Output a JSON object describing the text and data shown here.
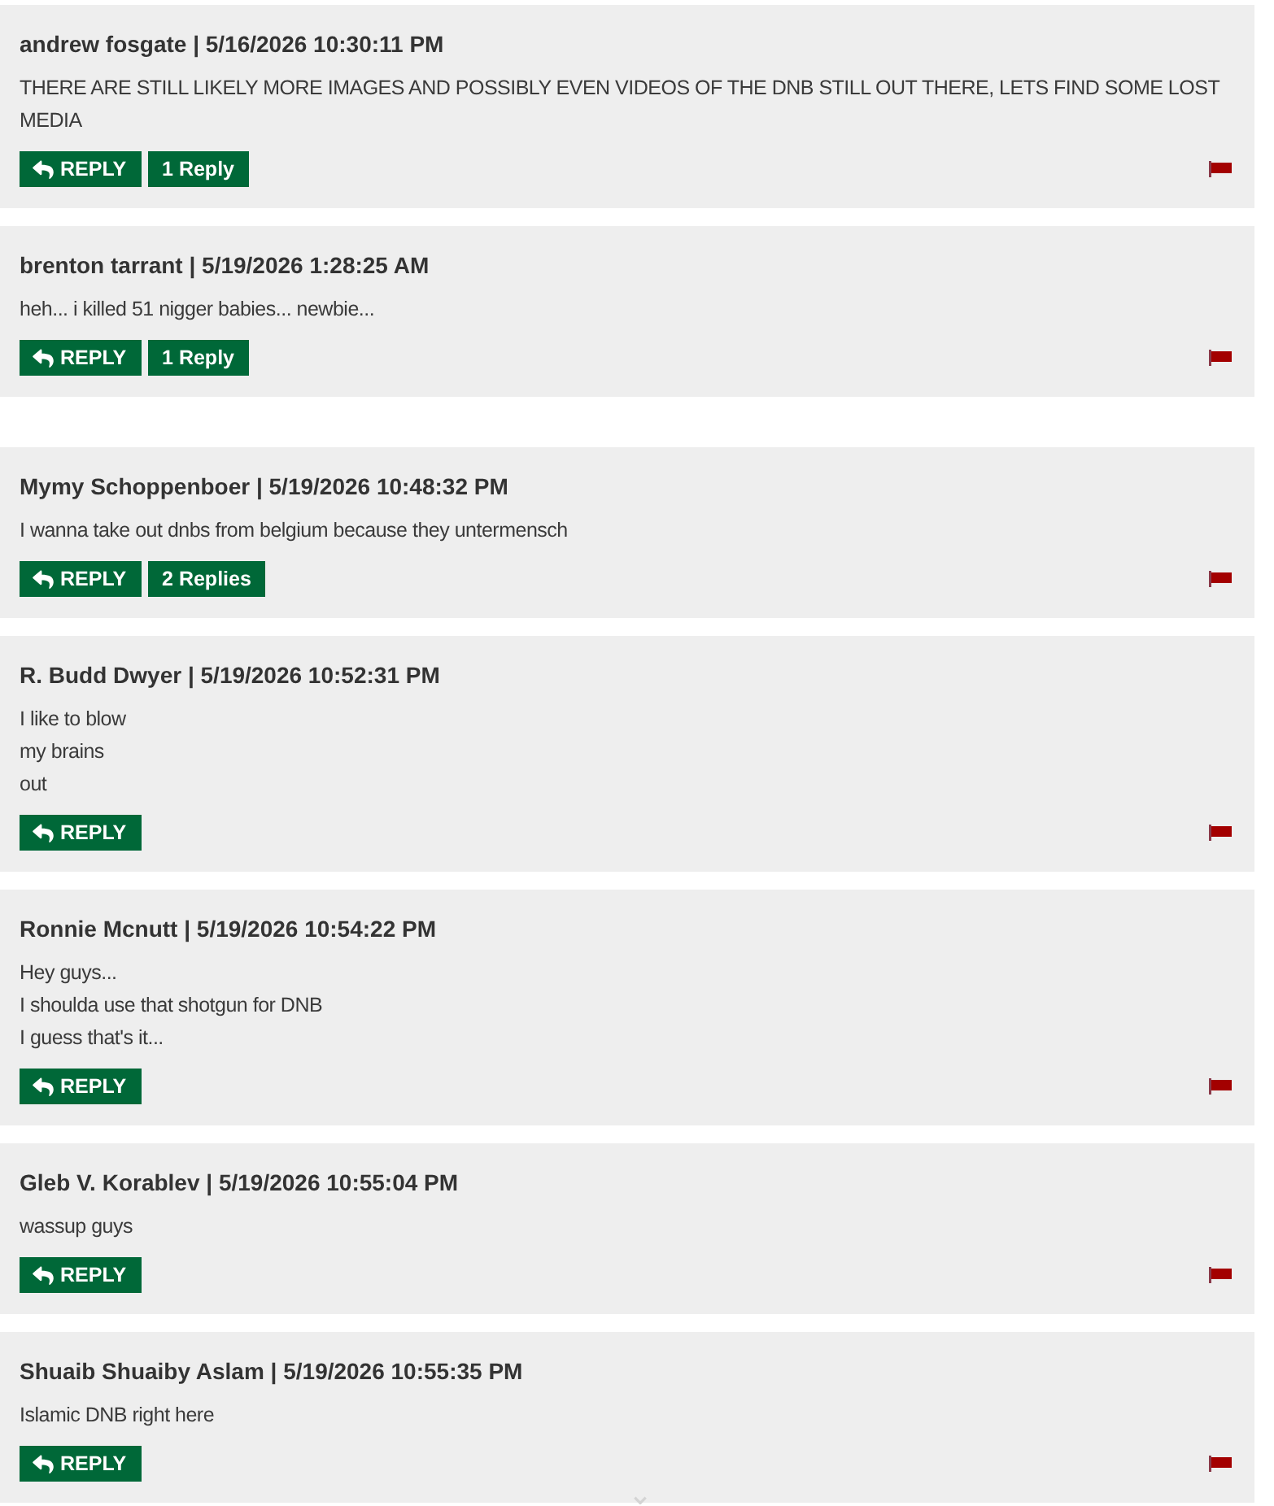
{
  "comments": [
    {
      "header": "andrew fosgate | 5/16/2026 10:30:11 PM",
      "body": "THERE ARE STILL LIKELY MORE IMAGES AND POSSIBLY EVEN VIDEOS OF THE DNB STILL OUT THERE, LETS FIND SOME LOST MEDIA",
      "reply_button": "REPLY",
      "replies_button": "1 Reply"
    },
    {
      "header": "brenton tarrant | 5/19/2026 1:28:25 AM",
      "body": "heh... i killed 51 nigger babies... newbie...",
      "reply_button": "REPLY",
      "replies_button": "1 Reply"
    },
    {
      "header": "Mymy Schoppenboer | 5/19/2026 10:48:32 PM",
      "body": "I wanna take out dnbs from belgium because they untermensch",
      "reply_button": "REPLY",
      "replies_button": "2 Replies"
    },
    {
      "header": "R. Budd Dwyer | 5/19/2026 10:52:31 PM",
      "body": "I like to blow\nmy brains\nout",
      "reply_button": "REPLY"
    },
    {
      "header": "Ronnie Mcnutt | 5/19/2026 10:54:22 PM",
      "body": "Hey guys...\nI shoulda use that shotgun for DNB\nI guess that's it...",
      "reply_button": "REPLY"
    },
    {
      "header": "Gleb V. Korablev | 5/19/2026 10:55:04 PM",
      "body": "wassup guys",
      "reply_button": "REPLY"
    },
    {
      "header": "Shuaib Shuaiby Aslam | 5/19/2026 10:55:35 PM",
      "body": "Islamic DNB right here",
      "reply_button": "REPLY"
    }
  ]
}
